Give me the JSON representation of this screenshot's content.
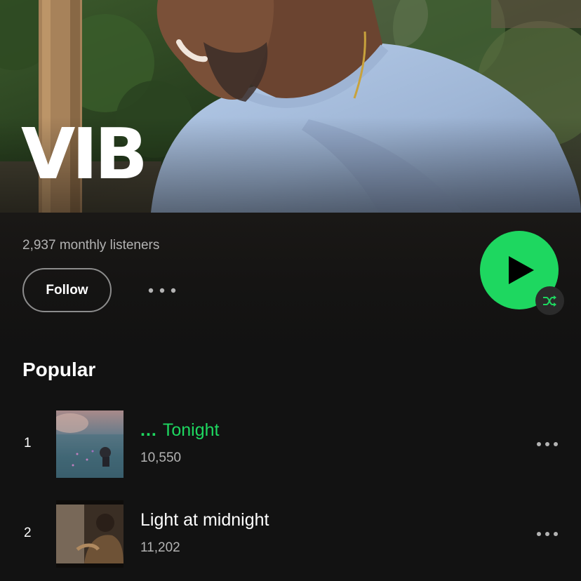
{
  "artist": {
    "name": "VIB",
    "monthly_listeners": "2,937 monthly listeners",
    "follow_label": "Follow"
  },
  "icons": {
    "more": "more-horizontal-icon",
    "play": "play-icon",
    "shuffle": "shuffle-icon",
    "now_playing": "now-playing-icon"
  },
  "colors": {
    "accent": "#1ed760",
    "background": "#121212",
    "secondary_text": "#b3b3b3"
  },
  "popular": {
    "title": "Popular",
    "tracks": [
      {
        "rank": "1",
        "title": "Tonight",
        "playing_indicator": "...",
        "plays": "10,550",
        "playing": true
      },
      {
        "rank": "2",
        "title": "Light at midnight",
        "plays": "11,202",
        "playing": false
      }
    ]
  }
}
